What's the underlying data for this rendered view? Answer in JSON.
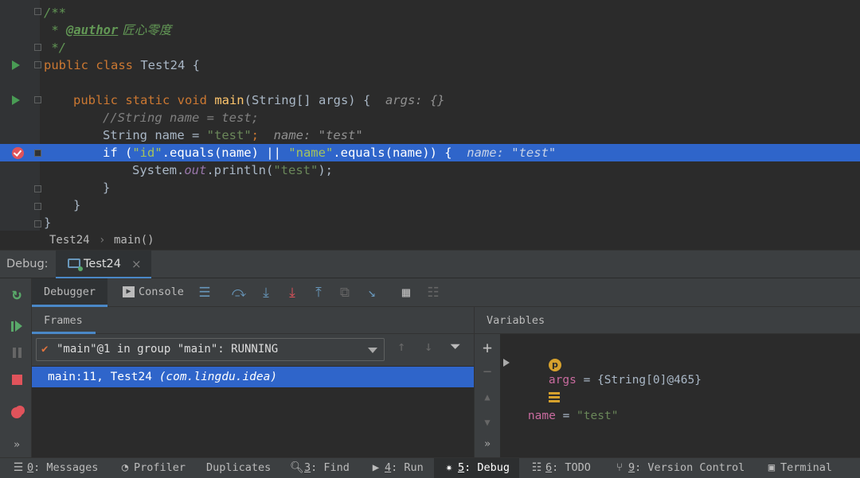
{
  "editor": {
    "lines": {
      "doc_open": "/**",
      "doc_star": " * ",
      "author_tag": "@author",
      "author_name": " 匠心零度",
      "doc_close": " */",
      "class_kw": "public class ",
      "class_name": "Test24 {",
      "main_kw": "public static void ",
      "main_name": "main",
      "main_params": "(String[] args) {",
      "main_hint": "args: {}",
      "comment": "//String name = test;",
      "decl_type": "String name = ",
      "decl_value": "\"test\"",
      "decl_semi": ";",
      "decl_hint": "name: \"test\"",
      "if_kw": "if (",
      "if_str1": "\"id\"",
      "if_mid": ".equals(name) || ",
      "if_str2": "\"name\"",
      "if_end": ".equals(name)) {",
      "if_hint": "name: \"test\"",
      "print_start": "System.",
      "print_field": "out",
      "print_call": ".println(",
      "print_str": "\"test\"",
      "print_end": ");",
      "brace_inner": "}",
      "brace_method": "}",
      "brace_class": "}"
    }
  },
  "breadcrumb": {
    "items": [
      "Test24",
      "›",
      "main()"
    ]
  },
  "debug": {
    "label": "Debug:",
    "session_tab": "Test24",
    "close_glyph": "×"
  },
  "tabs": {
    "debugger": "Debugger",
    "console": "Console"
  },
  "frames": {
    "title": "Frames",
    "thread": "\"main\"@1 in group \"main\": RUNNING",
    "frame_location": "main:11, Test24 ",
    "frame_package": "(com.lingdu.idea)"
  },
  "variables": {
    "title": "Variables",
    "items": [
      {
        "badge": "p",
        "name": "args",
        "eq": " = ",
        "value": "{String[0]@465}"
      },
      {
        "name": "name",
        "eq": " = ",
        "value": "\"test\""
      }
    ]
  },
  "status_bar": {
    "items": [
      {
        "num": "0",
        "label": ": Messages"
      },
      {
        "label": "Profiler"
      },
      {
        "label": "Duplicates"
      },
      {
        "num": "3",
        "label": ": Find"
      },
      {
        "num": "4",
        "label": ": Run"
      },
      {
        "num": "5",
        "label": ": Debug"
      },
      {
        "num": "6",
        "label": ": TODO"
      },
      {
        "num": "9",
        "label": ": Version Control"
      },
      {
        "label": "Terminal"
      }
    ]
  },
  "colors": {
    "editor_bg": "#2b2b2b",
    "panel_bg": "#3c3f41",
    "selection": "#2f65ca",
    "accent_tab": "#4a88c7",
    "keyword": "#cc7832",
    "string": "#6a8759",
    "method": "#ffc66d",
    "breakpoint": "#e0535b"
  },
  "icons": [
    "run-gutter-icon",
    "breakpoint-icon",
    "fold-icon",
    "rerun-icon",
    "resume-icon",
    "pause-icon",
    "stop-icon",
    "mute-breakpoints-icon",
    "step-over-icon",
    "step-into-icon",
    "force-step-into-icon",
    "step-out-icon",
    "drop-frame-icon",
    "run-to-cursor-icon",
    "evaluate-icon",
    "trace-icon",
    "filter-icon",
    "add-watch-icon"
  ]
}
